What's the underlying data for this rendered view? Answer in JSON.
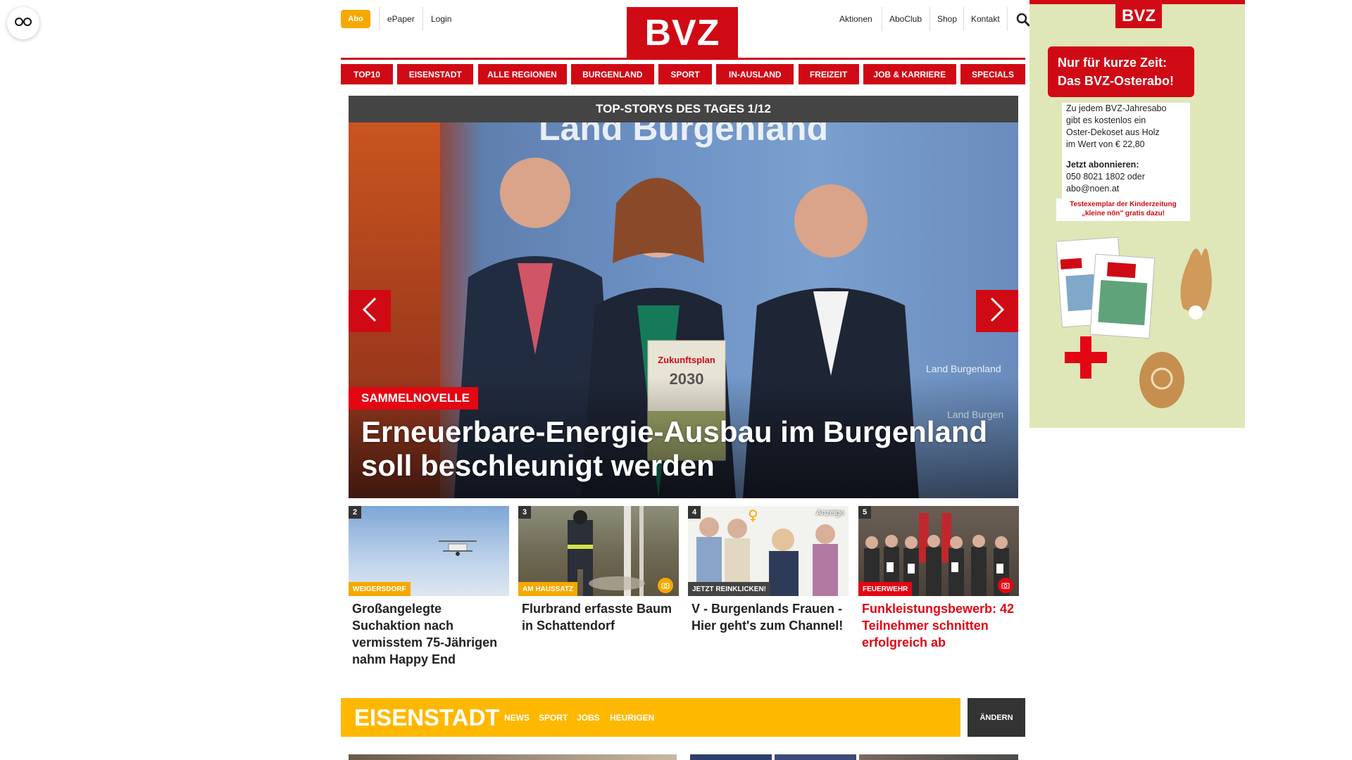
{
  "header": {
    "abo_label": "Abo",
    "epaper_label": "ePaper",
    "login_label": "Login",
    "logo_text": "BVZ",
    "right_links": [
      "Aktionen",
      "AboClub",
      "Shop",
      "Kontakt"
    ],
    "search_icon": "search-icon",
    "reader_icon": "glasses-icon"
  },
  "nav": {
    "items": [
      "TOP10",
      "EISENSTADT",
      "ALLE REGIONEN",
      "BURGENLAND",
      "SPORT",
      "IN-AUSLAND",
      "FREIZEIT",
      "JOB & KARRIERE",
      "SPECIALS"
    ]
  },
  "hero": {
    "bar_title": "TOP-STORYS DES TAGES 1/12",
    "tag": "SAMMELNOVELLE",
    "title": "Erneuerbare-Energie-Ausbau im Burgenland soll beschleunigt werden",
    "backdrop_text": "Land Burgenland",
    "brochure_text": "Zukunftsplan Burgenland 2030",
    "prev_icon": "chevron-left-icon",
    "next_icon": "chevron-right-icon"
  },
  "cards": [
    {
      "num": "2",
      "tag": "WEIGERSDORF",
      "tag_color": "#f5a800",
      "title": "Großangelegte Suchaktion nach vermisstem 75-Jährigen nahm Happy End",
      "title_color": "#222222"
    },
    {
      "num": "3",
      "tag": "AM HAUSSATZ",
      "tag_color": "#f5a800",
      "title": "Flurbrand erfasste Baum in Schattendorf",
      "title_color": "#222222",
      "camera": true
    },
    {
      "num": "4",
      "tag": "JETZT REINKLICKEN!",
      "tag_color": "#444444",
      "title": "V - Burgenlands Frauen - Hier geht's zum Channel!",
      "title_color": "#222222",
      "badge": "Anzeige"
    },
    {
      "num": "5",
      "tag": "FEUERWEHR",
      "tag_color": "#e30613",
      "title": "Funkleistungsbewerb: 42 Teilnehmer schnitten erfolgreich ab",
      "title_color": "#e30613",
      "camera": true
    }
  ],
  "section": {
    "title": "EISENSTADT",
    "links": [
      "NEWS",
      "SPORT",
      "JOBS",
      "HEURIGEN"
    ],
    "change_label": "ÄNDERN"
  },
  "ad": {
    "logo": "BVZ",
    "headline_1": "Nur für kurze Zeit:",
    "headline_2": "Das BVZ-Osterabo!",
    "body_lines": [
      "Zu jedem BVZ-Jahresabo",
      "gibt es kostenlos ein",
      "Oster-Dekoset aus Holz",
      "im Wert von € 22,80"
    ],
    "cta": "Jetzt abonnieren:",
    "contact_1": "050 8021 1802 oder",
    "contact_2": "abo@noen.at",
    "testex_1": "Testexemplar der Kinderzeitung",
    "testex_2": "„kleine nön\" gratis dazu!"
  },
  "colors": {
    "brand_red": "#d00a15",
    "accent_yellow": "#ffb800",
    "dark_bar": "#444444"
  }
}
